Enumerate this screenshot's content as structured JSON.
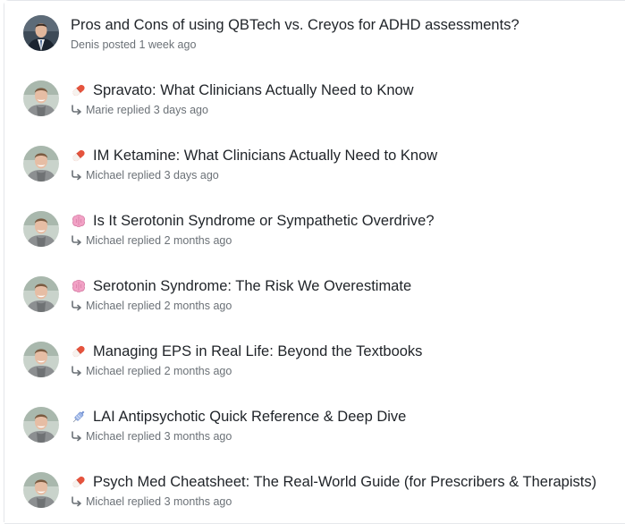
{
  "threads": [
    {
      "title": "Pros and Cons of using QBTech vs. Creyos for ADHD assessments?",
      "icon": null,
      "author": "Denis",
      "action": "posted",
      "time": "1 week ago",
      "reply": false,
      "avatar": "suit"
    },
    {
      "title": "Spravato: What Clinicians Actually Need to Know",
      "icon": "pill-icon",
      "author": "Marie",
      "action": "replied",
      "time": "3 days ago",
      "reply": true,
      "avatar": "casual"
    },
    {
      "title": "IM Ketamine: What Clinicians Actually Need to Know",
      "icon": "pill-icon",
      "author": "Michael",
      "action": "replied",
      "time": "3 days ago",
      "reply": true,
      "avatar": "casual"
    },
    {
      "title": "Is It Serotonin Syndrome or Sympathetic Overdrive?",
      "icon": "brain-icon",
      "author": "Michael",
      "action": "replied",
      "time": "2 months ago",
      "reply": true,
      "avatar": "casual"
    },
    {
      "title": "Serotonin Syndrome: The Risk We Overestimate",
      "icon": "brain-icon",
      "author": "Michael",
      "action": "replied",
      "time": "2 months ago",
      "reply": true,
      "avatar": "casual"
    },
    {
      "title": "Managing EPS in Real Life: Beyond the Textbooks",
      "icon": "pill-icon",
      "author": "Michael",
      "action": "replied",
      "time": "2 months ago",
      "reply": true,
      "avatar": "casual"
    },
    {
      "title": "LAI Antipsychotic Quick Reference & Deep Dive",
      "icon": "syringe-icon",
      "author": "Michael",
      "action": "replied",
      "time": "3 months ago",
      "reply": true,
      "avatar": "casual"
    },
    {
      "title": "Psych Med Cheatsheet: The Real-World Guide (for Prescribers & Therapists)",
      "icon": "pill-icon",
      "author": "Michael",
      "action": "replied",
      "time": "3 months ago",
      "reply": true,
      "avatar": "casual"
    }
  ],
  "colors": {
    "title": "#1f2328",
    "meta": "#6b7177",
    "divider": "#e6e8eb",
    "pill_left": "#f08a5d",
    "pill_right": "#e5533d",
    "brain": "#f2a2c6",
    "syringe": "#9fb7e8"
  }
}
